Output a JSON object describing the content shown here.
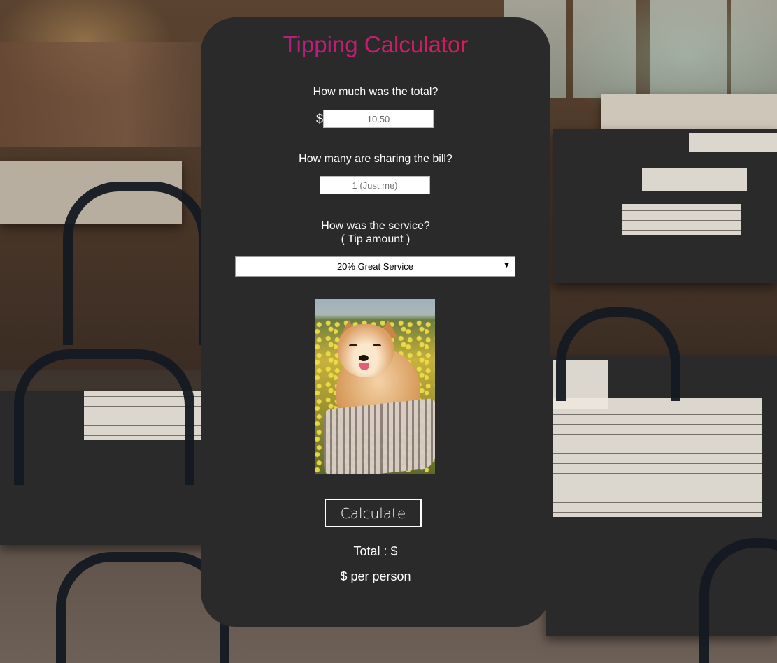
{
  "app": {
    "title": "Tipping Calculator"
  },
  "form": {
    "total_question": "How much was the total?",
    "currency_symbol": "$",
    "total_value": "10.50",
    "share_question": "How many are sharing the bill?",
    "share_placeholder": "1 (Just me)",
    "service_question": "How was the service?",
    "service_subtitle": "( Tip amount )",
    "service_selected": "20% Great Service",
    "image_alt": "Shiba Inu dog smiling in a basket among yellow flowers"
  },
  "actions": {
    "calculate_label": "Calculate"
  },
  "results": {
    "total_label": "Total : $",
    "per_person_label": "$ per person"
  },
  "colors": {
    "card_bg": "#2a2a2a",
    "title_gradient_start": "#a3238e",
    "title_gradient_end": "#e8194b",
    "text": "#ffffff"
  }
}
